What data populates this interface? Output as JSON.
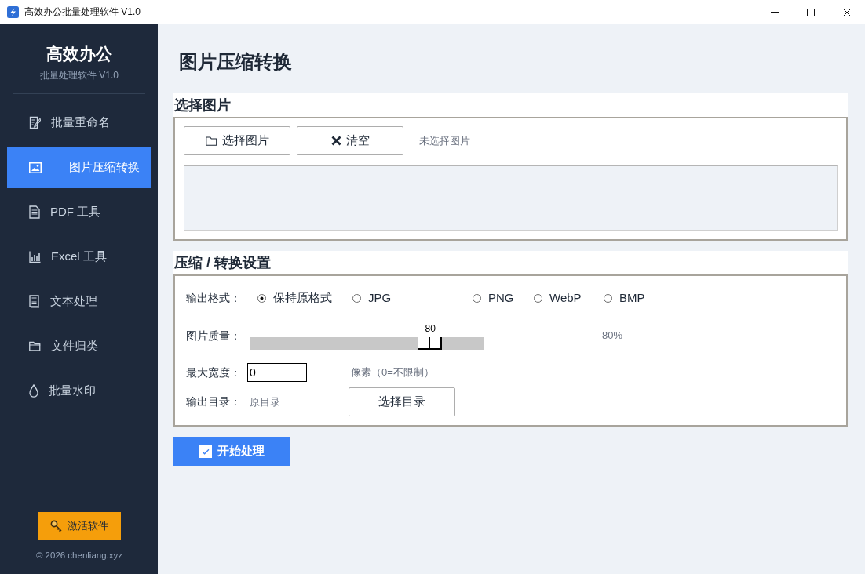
{
  "window": {
    "title": "高效办公批量处理软件 V1.0"
  },
  "sidebar": {
    "brand": "高效办公",
    "subtitle": "批量处理软件 V1.0",
    "items": [
      {
        "label": "批量重命名",
        "selected": false
      },
      {
        "label": "图片压缩转换",
        "selected": true
      },
      {
        "label": "PDF 工具",
        "selected": false
      },
      {
        "label": "Excel 工具",
        "selected": false
      },
      {
        "label": "文本处理",
        "selected": false
      },
      {
        "label": "文件归类",
        "selected": false
      },
      {
        "label": "批量水印",
        "selected": false
      }
    ],
    "activate_button": "激活软件",
    "footer": "© 2026 chenliang.xyz"
  },
  "page_title": "图片压缩转换",
  "select_section": {
    "title": "选择图片",
    "buttons": [
      {
        "label": "选择图片"
      },
      {
        "label": "清空"
      }
    ],
    "status": "未选择图片"
  },
  "settings_section": {
    "title": "压缩 / 转换设置",
    "format": {
      "label": "输出格式：",
      "options": [
        {
          "label": "保持原格式",
          "selected": true
        },
        {
          "label": "JPG",
          "selected": false
        },
        {
          "label": "PNG",
          "selected": false
        },
        {
          "label": "WebP",
          "selected": false
        },
        {
          "label": "BMP",
          "selected": false
        }
      ]
    },
    "quality": {
      "label": "图片质量：",
      "value": "80",
      "level": 0.8,
      "reading": "80%"
    },
    "max_width": {
      "label": "最大宽度：",
      "value": "0",
      "hint": "像素（0=不限制）"
    },
    "output_dir": {
      "label": "输出目录：",
      "value": "原目录",
      "button": "选择目录"
    }
  },
  "start_button": "开始处理"
}
